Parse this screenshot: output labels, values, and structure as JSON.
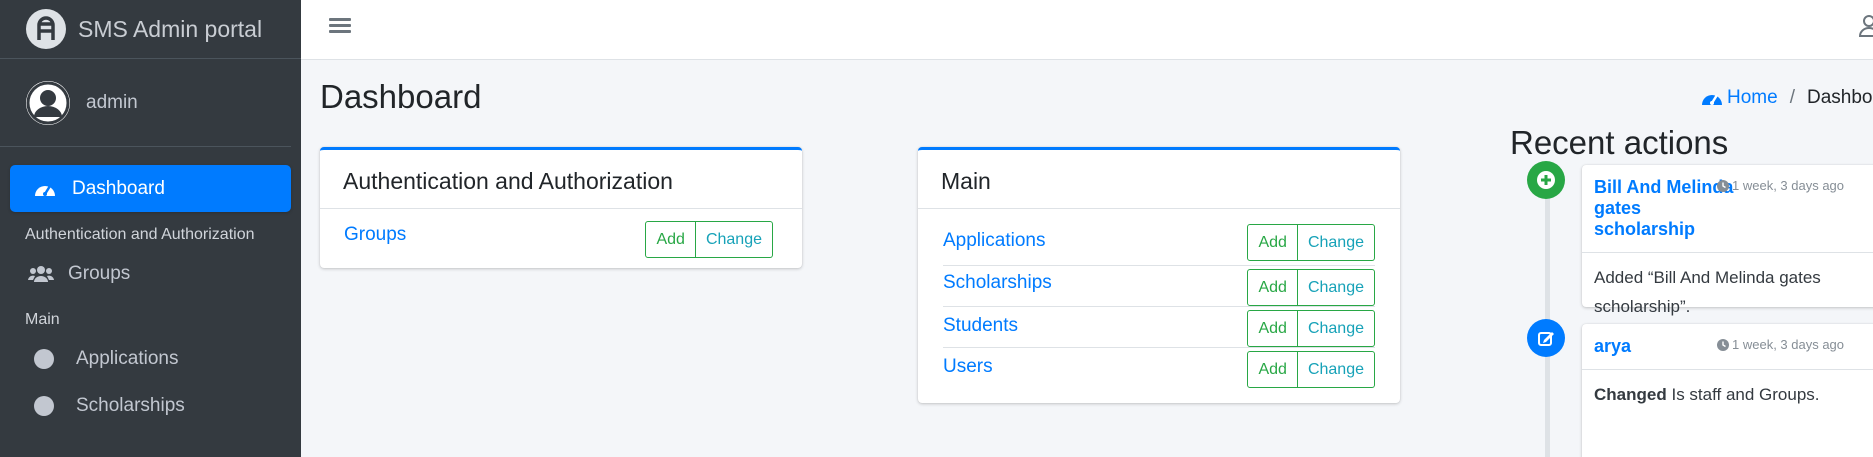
{
  "sidebar": {
    "brand": "SMS Admin portal",
    "user": "admin",
    "items": [
      {
        "label": "Dashboard",
        "active": true
      },
      {
        "header": "Authentication and Authorization"
      },
      {
        "label": "Groups"
      },
      {
        "header": "Main"
      },
      {
        "label": "Applications"
      },
      {
        "label": "Scholarships"
      }
    ]
  },
  "page": {
    "title": "Dashboard",
    "breadcrumb": {
      "home": "Home",
      "separator": "/",
      "current": "Dashboard"
    }
  },
  "modules": [
    {
      "title": "Authentication and Authorization",
      "rows": [
        {
          "name": "Groups",
          "add": "Add",
          "change": "Change"
        }
      ]
    },
    {
      "title": "Main",
      "rows": [
        {
          "name": "Applications",
          "add": "Add",
          "change": "Change"
        },
        {
          "name": "Scholarships",
          "add": "Add",
          "change": "Change"
        },
        {
          "name": "Students",
          "add": "Add",
          "change": "Change"
        },
        {
          "name": "Users",
          "add": "Add",
          "change": "Change"
        }
      ]
    }
  ],
  "recent": {
    "title": "Recent actions",
    "items": [
      {
        "icon": "plus-icon",
        "title": "Bill And Melinda gates scholarship",
        "time": "1 week, 3 days ago",
        "body": "Added “Bill And Melinda gates scholarship”."
      },
      {
        "icon": "edit-icon",
        "title": "arya",
        "time": "1 week, 3 days ago",
        "body_bold": "Changed",
        "body": "Is staff and Groups."
      }
    ]
  },
  "colors": {
    "primary": "#007bff",
    "success": "#28a745",
    "info": "#17a2b8",
    "sidebar": "#343a40"
  }
}
